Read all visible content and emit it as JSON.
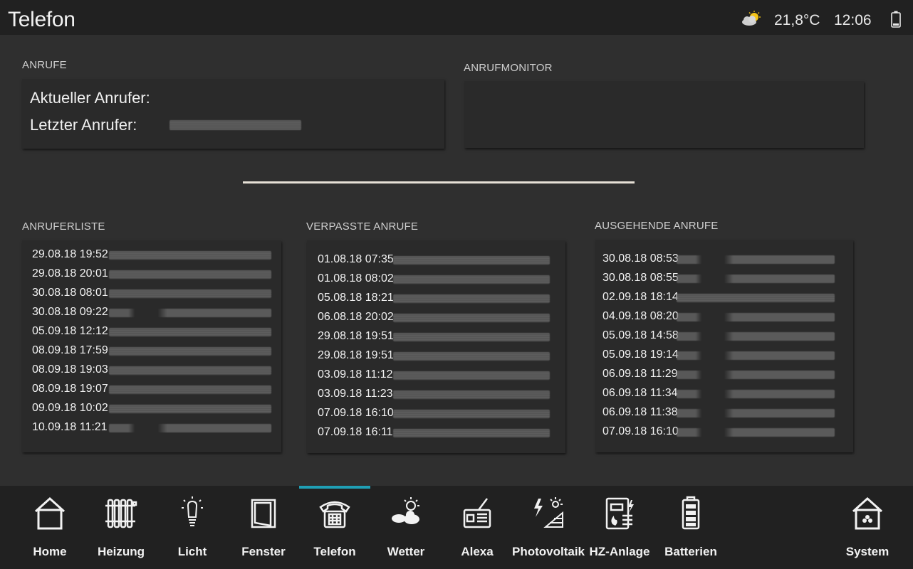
{
  "header": {
    "title": "Telefon",
    "temperature": "21,8°C",
    "time": "12:06",
    "weather_icon": "partly-cloudy-icon",
    "battery_icon": "battery-icon"
  },
  "sections": {
    "anrufe": {
      "label": "ANRUFE",
      "current_caller_label": "Aktueller Anrufer:",
      "last_caller_label": "Letzter Anrufer:"
    },
    "anrufmonitor": {
      "label": "ANRUFMONITOR"
    },
    "anruferliste": {
      "label": "ANRUFERLISTE",
      "entries": [
        "29.08.18 19:52",
        "29.08.18 20:01",
        "30.08.18 08:01",
        "30.08.18 09:22",
        "05.09.18 12:12",
        "08.09.18 17:59",
        "08.09.18 19:03",
        "08.09.18 19:07",
        "09.09.18 10:02",
        "10.09.18 11:21"
      ]
    },
    "verpasste": {
      "label": "VERPASSTE ANRUFE",
      "entries": [
        "01.08.18 07:35",
        "01.08.18 08:02",
        "05.08.18 18:21",
        "06.08.18 20:02",
        "29.08.18 19:51",
        "29.08.18 19:51",
        "03.09.18 11:12",
        "03.09.18 11:23",
        "07.09.18 16:10",
        "07.09.18 16:11"
      ]
    },
    "ausgehende": {
      "label": "AUSGEHENDE ANRUFE",
      "entries": [
        "30.08.18 08:53",
        "30.08.18 08:55",
        "02.09.18 18:14",
        "04.09.18 08:20",
        "05.09.18 14:58",
        "05.09.18 19:14",
        "06.09.18 11:29",
        "06.09.18 11:34",
        "06.09.18 11:38",
        "07.09.18 16:10"
      ]
    }
  },
  "nav": {
    "items": [
      {
        "label": "Home",
        "icon": "house-icon"
      },
      {
        "label": "Heizung",
        "icon": "radiator-icon"
      },
      {
        "label": "Licht",
        "icon": "light-bulb-icon"
      },
      {
        "label": "Fenster",
        "icon": "window-icon"
      },
      {
        "label": "Telefon",
        "icon": "telephone-icon",
        "active": true
      },
      {
        "label": "Wetter",
        "icon": "weather-icon"
      },
      {
        "label": "Alexa",
        "icon": "radio-icon"
      },
      {
        "label": "Photovoltaik",
        "icon": "solar-panel-icon"
      },
      {
        "label": "HZ-Anlage",
        "icon": "heating-system-icon"
      },
      {
        "label": "Batterien",
        "icon": "battery-icon"
      },
      {
        "label": "System",
        "icon": "system-house-icon"
      }
    ],
    "active_color": "#1f9fb5"
  }
}
